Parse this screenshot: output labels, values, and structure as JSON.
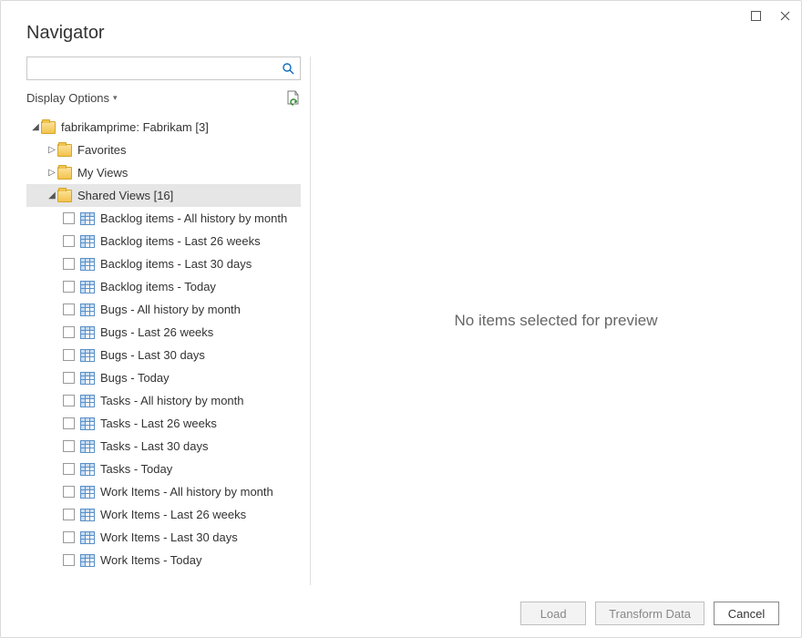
{
  "window": {
    "title": "Navigator"
  },
  "search": {
    "placeholder": ""
  },
  "options": {
    "display_label": "Display Options"
  },
  "tree": {
    "root": {
      "label": "fabrikamprime: Fabrikam [3]"
    },
    "favorites": {
      "label": "Favorites"
    },
    "myviews": {
      "label": "My Views"
    },
    "sharedviews": {
      "label": "Shared Views [16]"
    },
    "items": [
      {
        "label": "Backlog items - All history by month"
      },
      {
        "label": "Backlog items - Last 26 weeks"
      },
      {
        "label": "Backlog items - Last 30 days"
      },
      {
        "label": "Backlog items - Today"
      },
      {
        "label": "Bugs - All history by month"
      },
      {
        "label": "Bugs - Last 26 weeks"
      },
      {
        "label": "Bugs - Last 30 days"
      },
      {
        "label": "Bugs - Today"
      },
      {
        "label": "Tasks - All history by month"
      },
      {
        "label": "Tasks - Last 26 weeks"
      },
      {
        "label": "Tasks - Last 30 days"
      },
      {
        "label": "Tasks - Today"
      },
      {
        "label": "Work Items - All history by month"
      },
      {
        "label": "Work Items - Last 26 weeks"
      },
      {
        "label": "Work Items - Last 30 days"
      },
      {
        "label": "Work Items - Today"
      }
    ]
  },
  "preview": {
    "empty_message": "No items selected for preview"
  },
  "footer": {
    "load": "Load",
    "transform": "Transform Data",
    "cancel": "Cancel"
  }
}
